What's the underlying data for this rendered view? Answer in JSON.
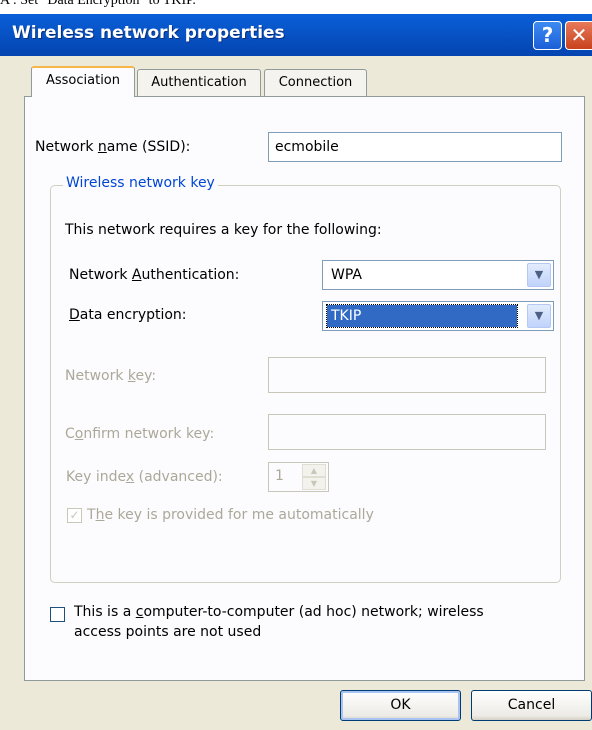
{
  "caption": "A : Set \"Data Encryption\" to TKIP.",
  "window": {
    "title": "Wireless network properties",
    "help_label": "?",
    "close_label": "✕"
  },
  "tabs": [
    {
      "label": "Association",
      "active": true
    },
    {
      "label": "Authentication",
      "active": false
    },
    {
      "label": "Connection",
      "active": false
    }
  ],
  "association": {
    "ssid_label_pre": "Network ",
    "ssid_label_key": "n",
    "ssid_label_post": "ame (SSID):",
    "ssid_value": "ecmobile",
    "group_title": "Wireless network key",
    "requires_text": "This network requires a key for the following:",
    "auth_label_pre": "Network ",
    "auth_label_key": "A",
    "auth_label_post": "uthentication:",
    "auth_value": "WPA",
    "enc_label_key": "D",
    "enc_label_post": "ata encryption:",
    "enc_value": "TKIP",
    "netkey_label_pre": "Network ",
    "netkey_label_key": "k",
    "netkey_label_post": "ey:",
    "netkey_value": "",
    "confirm_label_pre": "C",
    "confirm_label_key": "o",
    "confirm_label_post": "nfirm network key:",
    "confirm_value": "",
    "keyindex_label_pre": "Key inde",
    "keyindex_label_key": "x",
    "keyindex_label_post": " (advanced):",
    "keyindex_value": "1",
    "auto_key_label_pre": "T",
    "auto_key_label_key": "h",
    "auto_key_label_post": "e key is provided for me automatically",
    "auto_key_checked": true,
    "adhoc_label_line1_pre": "This is a ",
    "adhoc_label_line1_key": "c",
    "adhoc_label_line1_post": "omputer-to-computer (ad hoc) network; wireless",
    "adhoc_label_line2": "access points are not used",
    "adhoc_checked": false
  },
  "buttons": {
    "ok": "OK",
    "cancel": "Cancel"
  },
  "icons": {
    "dropdown": "chevron-down-icon",
    "spin_up": "spin-up-icon",
    "spin_down": "spin-down-icon",
    "check": "check-icon"
  }
}
